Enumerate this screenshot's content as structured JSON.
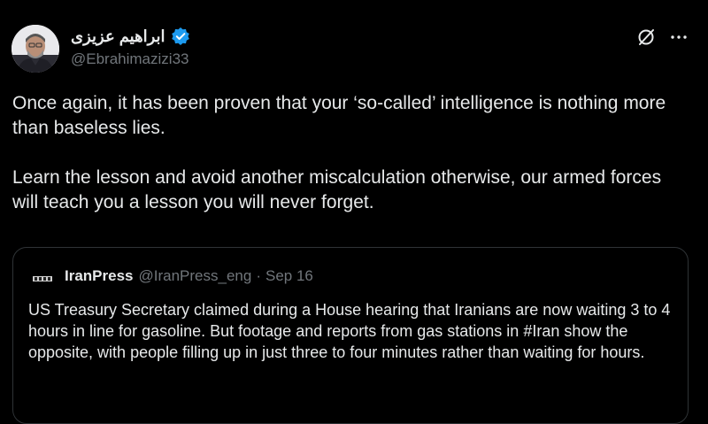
{
  "tweet": {
    "author": {
      "display_name": "ابراهیم عزیزی",
      "handle": "@Ebrahimazizi33",
      "verified": true,
      "avatar": "user-photo"
    },
    "text": "Once again, it has been proven that your ‘so-called’ intelligence is nothing more than baseless lies.\n\nLearn the lesson and avoid another miscalculation otherwise, our armed forces will teach you a lesson you will never forget.",
    "actions": {
      "grok_icon": "grok-icon",
      "more_icon": "more-icon"
    }
  },
  "quote": {
    "display_name": "IranPress",
    "handle": "@IranPress_eng",
    "separator": "·",
    "date": "Sep 16",
    "text": "US Treasury Secretary claimed during a House hearing that Iranians are now waiting 3 to 4 hours in line for gasoline. But footage and reports from gas stations in #Iran show the opposite, with people filling up in just three to four minutes rather than waiting for hours."
  },
  "colors": {
    "background": "#000000",
    "text_primary": "#e7e9ea",
    "text_secondary": "#71767b",
    "border": "#2f3336",
    "verified_blue": "#1d9bf0"
  }
}
